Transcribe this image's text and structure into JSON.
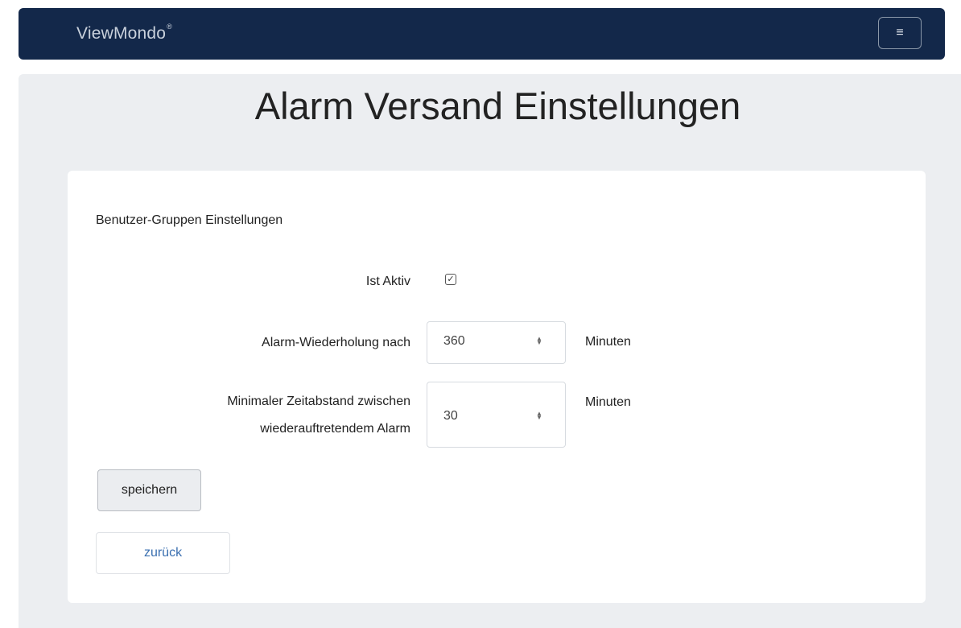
{
  "navbar": {
    "brand": "ViewMondo",
    "brand_mark": "®",
    "menu_icon": "hamburger-menu-icon",
    "menu_glyph": "≡"
  },
  "page": {
    "title": "Alarm Versand Einstellungen"
  },
  "card": {
    "section_title": "Benutzer-Gruppen Einstellungen",
    "active": {
      "label": "Ist Aktiv",
      "checked": true,
      "check_glyph": "✓"
    },
    "repeat": {
      "label": "Alarm-Wiederholung nach",
      "value": "360",
      "unit": "Minuten"
    },
    "min_interval": {
      "label_line1": "Minimaler Zeitabstand zwischen",
      "label_line2": "wiederauftretendem Alarm",
      "value": "30",
      "unit": "Minuten"
    },
    "save_label": "speichern",
    "back_label": "zurück",
    "spinner_up": "▲",
    "spinner_down": "▼"
  },
  "colors": {
    "navbar_bg": "#13284a",
    "page_bg": "#eceef1",
    "link": "#3a6fb0"
  }
}
